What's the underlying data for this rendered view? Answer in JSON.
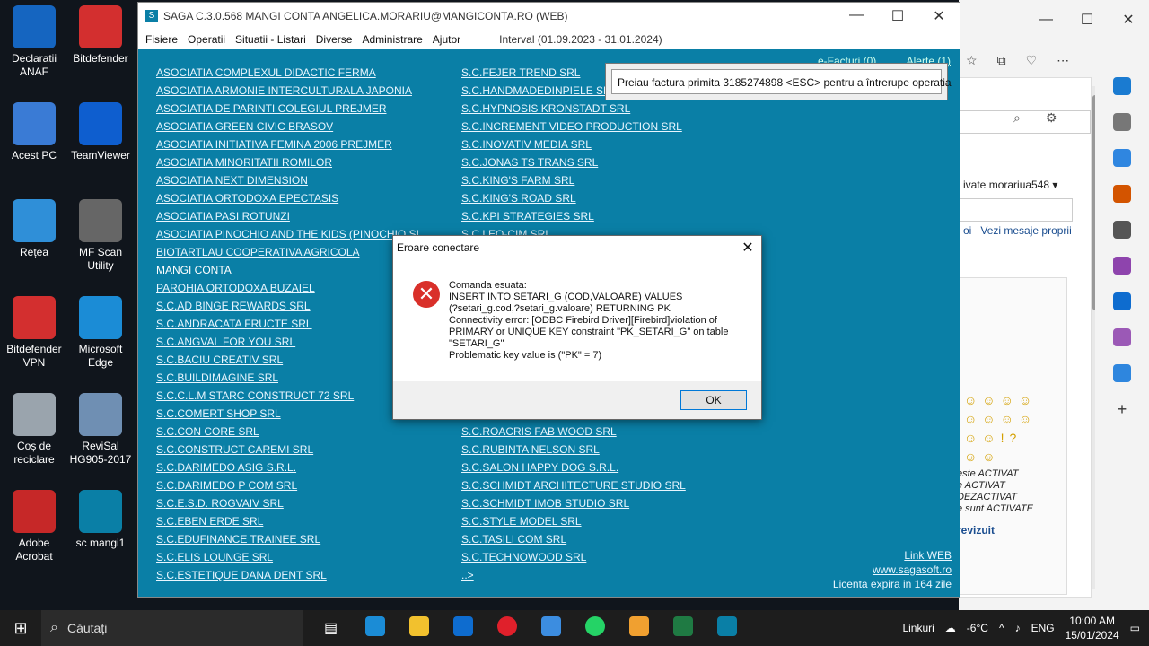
{
  "desktop": {
    "icons": [
      {
        "label": "Declaratii ANAF",
        "color": "#1565c0"
      },
      {
        "label": "Bitdefender",
        "color": "#d32f2f"
      },
      {
        "label": "Acest PC",
        "color": "#3a7bd5"
      },
      {
        "label": "TeamViewer",
        "color": "#0e5ecf"
      },
      {
        "label": "Rețea",
        "color": "#2f8fd8"
      },
      {
        "label": "MF Scan Utility",
        "color": "#666666"
      },
      {
        "label": "Bitdefender VPN",
        "color": "#d32f2f"
      },
      {
        "label": "Microsoft Edge",
        "color": "#1b8cd6"
      },
      {
        "label": "Coș de reciclare",
        "color": "#9aa4ad"
      },
      {
        "label": "ReviSal HG905-2017",
        "color": "#6f8fb3"
      },
      {
        "label": "Adobe Acrobat",
        "color": "#c62828"
      },
      {
        "label": "sc mangi1",
        "color": "#0a7fa6"
      }
    ]
  },
  "edge": {
    "user": "morariua548",
    "activate_text": "ivate",
    "link1": "oi",
    "link2": "Vezi mesaje proprii",
    "status_lines": [
      "este ACTIVAT",
      "e ACTIVAT",
      "DEZACTIVAT",
      "e sunt ACTIVATE"
    ],
    "revised": "revizuit"
  },
  "saga": {
    "title": "SAGA C.3.0.568  MANGI  CONTA  ANGELICA.MORARIU@MANGICONTA.RO     (WEB)",
    "menu": [
      "Fisiere",
      "Operatii",
      "Situatii - Listari",
      "Diverse",
      "Administrare",
      "Ajutor"
    ],
    "interval": "Interval (01.09.2023 - 31.01.2024)",
    "facturi": "e-Facturi (0)",
    "alerte": "Alerte (1)",
    "companies_left": [
      "ASOCIATIA  COMPLEXUL DIDACTIC FERMA",
      "ASOCIATIA ARMONIE INTERCULTURALA JAPONIA",
      "ASOCIATIA DE PARINTI COLEGIUL PREJMER",
      "ASOCIATIA GREEN CIVIC BRASOV",
      "ASOCIATIA INITIATIVA  FEMINA 2006 PREJMER",
      "ASOCIATIA MINORITATII ROMILOR",
      "ASOCIATIA NEXT DIMENSION",
      "ASOCIATIA ORTODOXA EPECTASIS",
      "ASOCIATIA PASI ROTUNZI",
      "ASOCIATIA PINOCHIO AND THE KIDS (PINOCHIO SI",
      "BIOTARTLAU COOPERATIVA AGRICOLA",
      "MANGI  CONTA",
      "PAROHIA ORTODOXA BUZAIEL",
      "S.C.AD BINGE REWARDS SRL",
      "S.C.ANDRACATA FRUCTE SRL",
      "S.C.ANGVAL FOR YOU SRL",
      "S.C.BACIU CREATIV SRL",
      "S.C.BUILDIMAGINE SRL",
      "S.C.C.L.M STARC CONSTRUCT 72 SRL",
      "S.C.COMERT SHOP SRL",
      "S.C.CON CORE SRL",
      "S.C.CONSTRUCT CAREMI SRL",
      "S.C.DARIMEDO ASIG S.R.L.",
      "S.C.DARIMEDO P COM SRL",
      "S.C.E.S.D. ROGVAIV SRL",
      "S.C.EBEN ERDE SRL",
      "S.C.EDUFINANCE TRAINEE SRL",
      "S.C.ELIS LOUNGE SRL",
      "S.C.ESTETIQUE DANA DENT SRL"
    ],
    "companies_right_top": [
      "S.C.FEJER TREND SRL",
      "S.C.HANDMADEDINPIELE SRL",
      "S.C.HYPNOSIS KRONSTADT SRL",
      "S.C.INCREMENT VIDEO PRODUCTION SRL",
      "S.C.INOVATIV MEDIA SRL",
      "S.C.JONAS TS TRANS SRL",
      "S.C.KING'S FARM SRL",
      "S.C.KING'S ROAD SRL",
      "S.C.KPI STRATEGIES SRL",
      "S.C.LEO-CIM SRL"
    ],
    "companies_right_bottom": [
      "S.C.ROACRIS FAB WOOD SRL",
      "S.C.RUBINTA NELSON SRL",
      "S.C.SALON HAPPY DOG S.R.L.",
      "S.C.SCHMIDT ARCHITECTURE STUDIO SRL",
      "S.C.SCHMIDT IMOB STUDIO SRL",
      "S.C.STYLE MODEL SRL",
      "S.C.TASILI COM SRL",
      "S.C.TECHNOWOOD  SRL",
      "..>"
    ],
    "link_web": "Link WEB",
    "site": "www.sagasoft.ro",
    "license": "Licenta expira in 164 zile"
  },
  "status_popup": "Preiau factura primita 3185274898 <ESC> pentru a întrerupe operatia",
  "dialog": {
    "title": "Eroare conectare",
    "lines": [
      "Comanda esuata:",
      "INSERT INTO SETARI_G (COD,VALOARE) VALUES",
      "(?setari_g.cod,?setari_g.valoare) RETURNING PK",
      "Connectivity error: [ODBC Firebird Driver][Firebird]violation of",
      "PRIMARY or UNIQUE KEY constraint \"PK_SETARI_G\" on table",
      "\"SETARI_G\"",
      "Problematic key value is (\"PK\" = 7)"
    ],
    "ok": "OK"
  },
  "taskbar": {
    "search_placeholder": "Căutați",
    "links": "Linkuri",
    "temp": "-6°C",
    "lang": "ENG",
    "time": "10:00 AM",
    "date": "15/01/2024"
  }
}
